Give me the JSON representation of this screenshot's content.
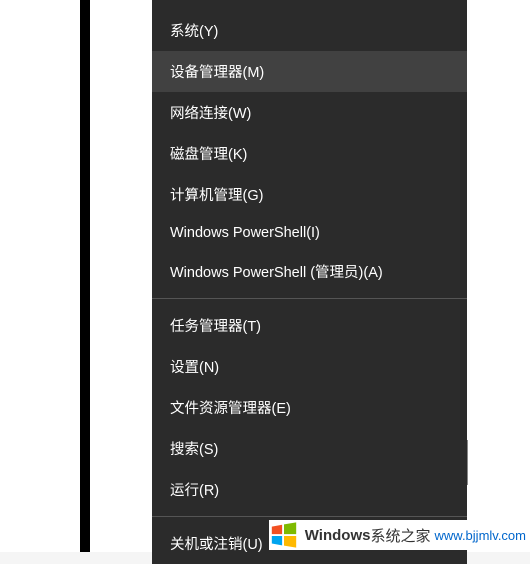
{
  "menu": {
    "groups": [
      [
        {
          "label": "系统(Y)",
          "name": "menu-item-system",
          "highlighted": false
        },
        {
          "label": "设备管理器(M)",
          "name": "menu-item-device-manager",
          "highlighted": true
        },
        {
          "label": "网络连接(W)",
          "name": "menu-item-network-connections",
          "highlighted": false
        },
        {
          "label": "磁盘管理(K)",
          "name": "menu-item-disk-management",
          "highlighted": false
        },
        {
          "label": "计算机管理(G)",
          "name": "menu-item-computer-management",
          "highlighted": false
        },
        {
          "label": "Windows PowerShell(I)",
          "name": "menu-item-powershell",
          "highlighted": false
        },
        {
          "label": "Windows PowerShell (管理员)(A)",
          "name": "menu-item-powershell-admin",
          "highlighted": false
        }
      ],
      [
        {
          "label": "任务管理器(T)",
          "name": "menu-item-task-manager",
          "highlighted": false
        },
        {
          "label": "设置(N)",
          "name": "menu-item-settings",
          "highlighted": false
        },
        {
          "label": "文件资源管理器(E)",
          "name": "menu-item-file-explorer",
          "highlighted": false
        },
        {
          "label": "搜索(S)",
          "name": "menu-item-search",
          "highlighted": false
        },
        {
          "label": "运行(R)",
          "name": "menu-item-run",
          "highlighted": false
        }
      ],
      [
        {
          "label": "关机或注销(U)",
          "name": "menu-item-shutdown-signout",
          "highlighted": false
        }
      ]
    ]
  },
  "watermark": {
    "brand": "Windows",
    "suffix": "系统之家",
    "url": "www.bjjmlv.com"
  }
}
